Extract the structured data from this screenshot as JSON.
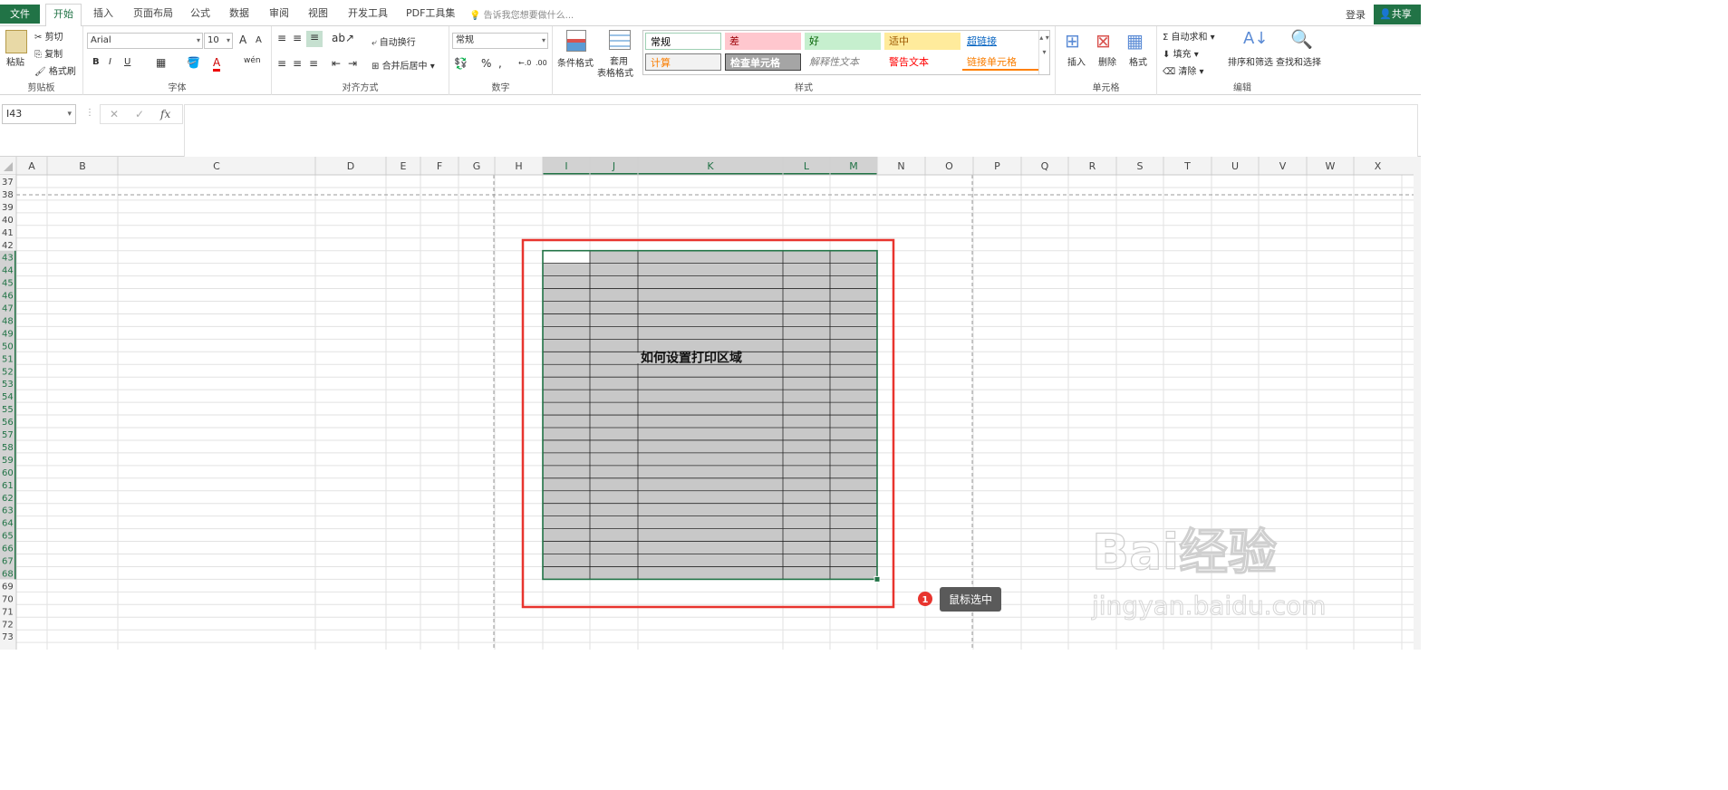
{
  "menu": {
    "file": "文件",
    "tabs": [
      "开始",
      "插入",
      "页面布局",
      "公式",
      "数据",
      "审阅",
      "视图",
      "开发工具",
      "PDF工具集"
    ],
    "tell_me": "告诉我您想要做什么...",
    "login": "登录",
    "share": "共享"
  },
  "ribbon": {
    "clipboard": {
      "paste": "粘贴",
      "cut": "剪切",
      "copy": "复制",
      "format_painter": "格式刷",
      "name": "剪贴板"
    },
    "font": {
      "family": "Arial",
      "size": "10",
      "bold": "B",
      "italic": "I",
      "underline": "U",
      "name": "字体",
      "grow": "A",
      "shrink": "A"
    },
    "alignment": {
      "wrap": "自动换行",
      "merge": "合并后居中",
      "name": "对齐方式"
    },
    "number": {
      "format": "常规",
      "percent": "%",
      "comma": ",",
      "name": "数字"
    },
    "styles": {
      "cond_format": "条件格式",
      "table_format_1": "套用",
      "table_format_2": "表格格式",
      "cells": [
        {
          "label": "常规",
          "bg": "#ffffff",
          "fg": "#000000",
          "border": "#9fd0b4"
        },
        {
          "label": "差",
          "bg": "#ffc7ce",
          "fg": "#9c0006"
        },
        {
          "label": "好",
          "bg": "#c6efce",
          "fg": "#006100"
        },
        {
          "label": "适中",
          "bg": "#ffeb9c",
          "fg": "#9c5700"
        },
        {
          "label": "超链接",
          "bg": "#ffffff",
          "fg": "#0563c1",
          "underline": true
        },
        {
          "label": "计算",
          "bg": "#f2f2f2",
          "fg": "#fa7d00",
          "border": "#7f7f7f"
        },
        {
          "label": "检查单元格",
          "bg": "#a5a5a5",
          "fg": "#ffffff",
          "border": "#3f3f3f",
          "bold": true
        },
        {
          "label": "解释性文本",
          "bg": "#ffffff",
          "fg": "#7f7f7f",
          "italic": true
        },
        {
          "label": "警告文本",
          "bg": "#ffffff",
          "fg": "#ff0000"
        },
        {
          "label": "链接单元格",
          "bg": "#ffffff",
          "fg": "#fa7d00",
          "bottom": "#ff8001"
        }
      ],
      "name": "样式"
    },
    "cells": {
      "insert": "插入",
      "delete": "删除",
      "format": "格式",
      "name": "单元格"
    },
    "editing": {
      "autosum": "自动求和",
      "fill": "填充",
      "clear": "清除",
      "sort": "排序和筛选",
      "find": "查找和选择",
      "name": "编辑"
    }
  },
  "formula_bar": {
    "name_box": "I43",
    "cancel": "✕",
    "enter": "✓",
    "fx": "fx",
    "value": ""
  },
  "sheet": {
    "columns": [
      "A",
      "B",
      "C",
      "D",
      "E",
      "F",
      "G",
      "H",
      "I",
      "J",
      "K",
      "L",
      "M",
      "N",
      "O",
      "P",
      "Q",
      "R",
      "S",
      "T",
      "U",
      "V",
      "W",
      "X"
    ],
    "first_row": 37,
    "last_row": 73,
    "selected_columns": [
      "I",
      "J",
      "K",
      "L",
      "M"
    ],
    "selection_rows": [
      43,
      68
    ],
    "active_cell": "I43",
    "merged_text": "如何设置打印区域",
    "selection_fill": "#c8c8c8",
    "accent": "#217346",
    "highlight_color": "#e8342e"
  },
  "annotation": {
    "number": "1",
    "text": "鼠标选中"
  },
  "watermark": {
    "logo": "Bai经验",
    "url": "jingyan.baidu.com"
  }
}
